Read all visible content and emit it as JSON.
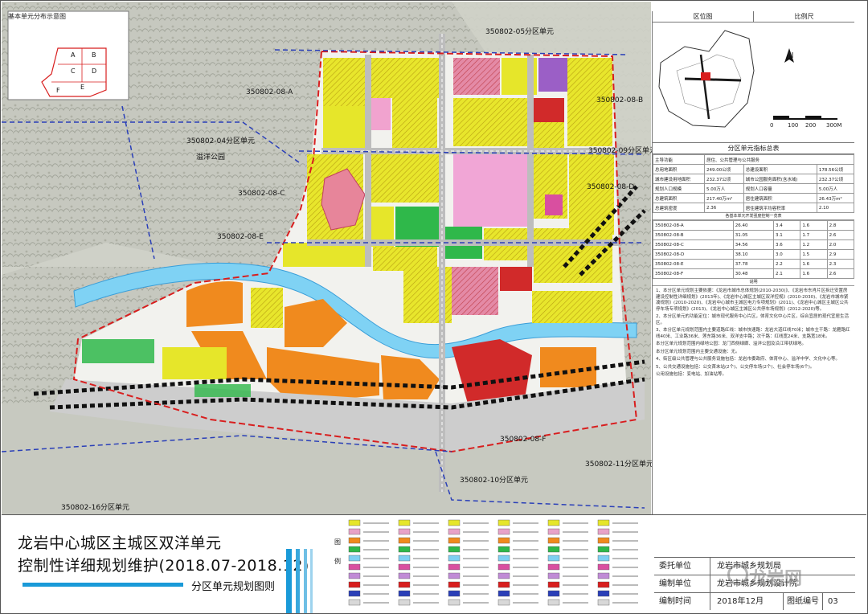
{
  "inset": {
    "title": "基本单元分布示意图",
    "cells": [
      "A",
      "B",
      "C",
      "D",
      "E",
      "F"
    ]
  },
  "map_labels": {
    "unit_05": "350802-05分区单元",
    "unit_04": "350802-04分区单元",
    "unit_09": "350802-09分区单元",
    "unit_11": "350802-11分区单元",
    "unit_10": "350802-10分区单元",
    "unit_16": "350802-16分区单元",
    "sub_a": "350802-08-A",
    "sub_b": "350802-08-B",
    "sub_c": "350802-08-C",
    "sub_d": "350802-08-D",
    "sub_e": "350802-08-E",
    "sub_f": "350802-08-F",
    "park": "溢洋公园"
  },
  "side": {
    "location_title": "区位图",
    "scale_title": "比例尺",
    "north": "N",
    "scale_ticks": [
      "0",
      "100",
      "200",
      "300M"
    ],
    "index_title": "分区单元指标总表",
    "index_rows": [
      [
        "主导功能",
        "居住、公共管理与公共服务",
        "",
        ""
      ],
      [
        "总用地面积",
        "249.00公顷",
        "总建设面积",
        "178.56公顷"
      ],
      [
        "城市建设用地面积",
        "232.37公顷",
        "城市公园服务面积(含水域)",
        "232.37公顷"
      ],
      [
        "规划人口规模",
        "5.00万人",
        "规划人口容量",
        "5.00万人"
      ],
      [
        "总建筑面积",
        "217.40万m²",
        "居住建筑面积",
        "26.43万m²"
      ],
      [
        "总建筑密度",
        "2.36",
        "居住建筑平均容积率",
        "2.10"
      ]
    ],
    "sub_title": "各基本单元开发强度控制一览表",
    "sub_rows": [
      [
        "350802-08-A",
        "26.40",
        "3.4",
        "1.6",
        "2.8"
      ],
      [
        "350802-08-B",
        "31.05",
        "3.1",
        "1.7",
        "2.6"
      ],
      [
        "350802-08-C",
        "34.56",
        "3.6",
        "1.2",
        "2.0"
      ],
      [
        "350802-08-D",
        "38.10",
        "3.0",
        "1.5",
        "2.9"
      ],
      [
        "350802-08-E",
        "37.78",
        "2.2",
        "1.6",
        "2.3"
      ],
      [
        "350802-08-F",
        "30.48",
        "2.1",
        "1.6",
        "2.6"
      ]
    ],
    "notes_title": "说明",
    "notes": [
      "1、本分区单元规划主要依据：《龙岩市城市总体规划(2010-2030)》、《龙岩市东肖片区拆迁安置房建设控制性详细规划》(2013年)、《龙岩中心城区主城区双洋控规》(2010-2030)、《龙岩市城市紧凑规划》(2010-2020)、《龙岩中心城市主城区电力专项规划》(2011)、《龙岩中心城区主城区公共停车场专项规划》(2013)、《龙岩中心城区主城区公共停车场规划》(2012-2020)等。",
      "2、本分区单元的功能定位：城市现代服务中心片区，体育文化中心片区，综合宜居的现代宜居生活区。",
      "3、本分区单元规划范围内主要道路红线：城市快速路：龙岩大道红线70米；城市主干路：龙雁路红线40米、工业路36米、莲东路36米、双洋支中路；次干路：红线宽24米、支路宽18米。",
      "本分区单元规划范围内绿地公园：龙门西侧绿廊、溢洋公园及沿江带状绿地。",
      "本分区单元规划范围内主要交通设施：无。",
      "4、街区级公共管理与公共服务设施包括：龙岩市委政府、体育中心、溢洋中学、文化中心等。",
      "5、公共交通设施包括：公交首末站(2个)、公交停车场(2个)、社会停车场(6个)。",
      "公用设施包括：变电站、加油站等。"
    ]
  },
  "title_block": {
    "line1": "龙岩中心城区主城区双洋单元",
    "line2": "控制性详细规划维护(2018.07-2018.12)",
    "subtitle": "分区单元规划图则",
    "legend_label_a": "图",
    "legend_label_b": "例"
  },
  "info_block": {
    "approval_label": "委托单位",
    "approval_value": "龙岩市城乡规划局",
    "compile_label": "编制单位",
    "compile_value": "龙岩市城乡规划设计院",
    "time_label": "编制时间",
    "time_value": "2018年12月",
    "number_label": "图纸编号",
    "number_value": "03"
  },
  "watermark": "龙岩网",
  "colors": {
    "residential": "#e6e62a",
    "commercial": "#e8a2c8",
    "industrial": "#f08a1e",
    "green": "#2fb84a",
    "water": "#7ed0f2",
    "road": "#d8d8d8",
    "railway": "#111111",
    "boundary_blue": "#2a3fb8",
    "boundary_red": "#d81e1e",
    "hills": "#b9bcb2",
    "public": "#d94fa0",
    "education": "#c08bd6"
  }
}
